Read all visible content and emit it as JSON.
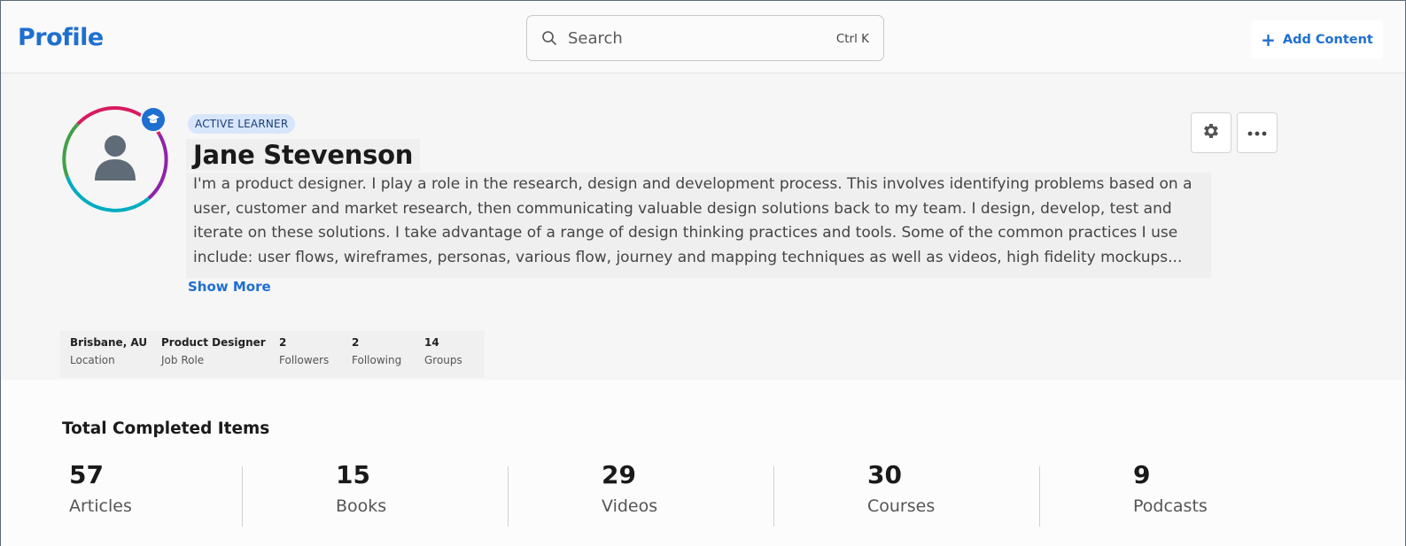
{
  "header": {
    "brand": "Profile",
    "search_placeholder": "Search",
    "search_shortcut": "Ctrl K",
    "add_label": "Add Content"
  },
  "profile": {
    "badge": "ACTIVE LEARNER",
    "name": "Jane Stevenson",
    "bio_lines": [
      "I'm a product designer. I play a role in the research, design and development process. This involves identifying problems based on a",
      "user, customer and market research, then communicating valuable design solutions back to my team. I design, develop, test and",
      "iterate on these solutions. I take advantage of a range of design thinking practices and tools. Some of the common practices I use",
      "include: user flows, wireframes, personas, various flow, journey and mapping techniques as well as videos, high fidelity mockups..."
    ],
    "show_more": "Show More",
    "avatar_ring_colors": [
      "#d81b60",
      "#8e24aa",
      "#00acc1",
      "#43a047"
    ],
    "badge_icon": "graduation-cap-icon"
  },
  "stats": [
    {
      "value": "Brisbane, AU",
      "label": "Location"
    },
    {
      "value": "Product Designer",
      "label": "Job Role"
    },
    {
      "value": "2",
      "label": "Followers"
    },
    {
      "value": "2",
      "label": "Following"
    },
    {
      "value": "14",
      "label": "Groups"
    }
  ],
  "completed": {
    "title": "Total Completed Items",
    "items": [
      {
        "count": "57",
        "label": "Articles"
      },
      {
        "count": "15",
        "label": "Books"
      },
      {
        "count": "29",
        "label": "Videos"
      },
      {
        "count": "30",
        "label": "Courses"
      },
      {
        "count": "9",
        "label": "Podcasts"
      }
    ]
  },
  "colors": {
    "accent": "#1f6fd1"
  }
}
